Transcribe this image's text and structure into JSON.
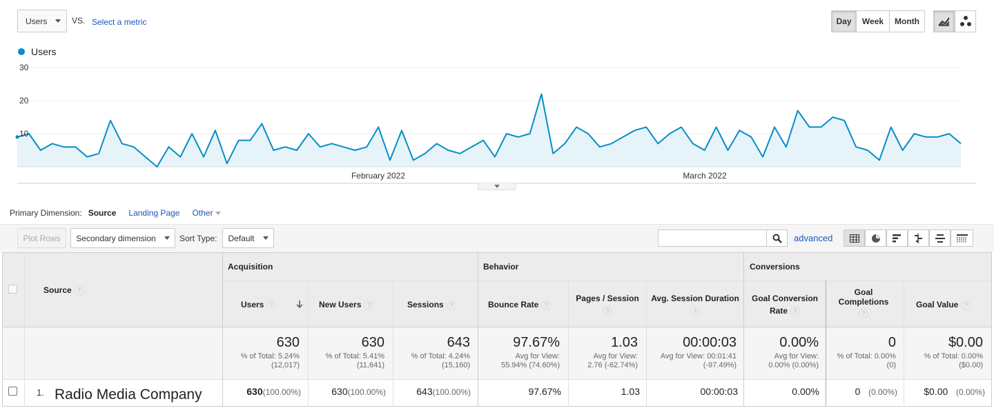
{
  "metric_bar": {
    "primary_metric": "Users",
    "vs_label": "VS.",
    "select_metric": "Select a metric"
  },
  "period": {
    "day": "Day",
    "week": "Week",
    "month": "Month",
    "active": "Day"
  },
  "chart_icons": [
    "line-chart-icon",
    "motion-chart-icon"
  ],
  "chart_data": {
    "type": "area",
    "series": [
      {
        "name": "Users",
        "color": "#058dc7",
        "values": [
          9,
          10,
          5,
          7,
          6,
          6,
          3,
          4,
          14,
          7,
          6,
          3,
          0,
          6,
          3,
          10,
          3,
          11,
          1,
          8,
          8,
          13,
          5,
          6,
          5,
          10,
          6,
          7,
          6,
          5,
          6,
          12,
          2,
          11,
          2,
          4,
          7,
          5,
          4,
          6,
          8,
          3,
          10,
          9,
          10,
          22,
          4,
          7,
          12,
          10,
          6,
          7,
          9,
          11,
          12,
          7,
          10,
          12,
          7,
          5,
          12,
          5,
          11,
          9,
          3,
          12,
          6,
          17,
          12,
          12,
          15,
          14,
          6,
          5,
          2,
          12,
          5,
          10,
          9,
          9,
          10,
          7
        ]
      }
    ],
    "y_ticks": [
      "10",
      "20",
      "30"
    ],
    "ylim": [
      0,
      30
    ],
    "x_labels": [
      "February 2022",
      "March 2022"
    ],
    "legend": "top-left",
    "grid": true
  },
  "dimension": {
    "label": "Primary Dimension:",
    "active": "Source",
    "options": [
      "Landing Page",
      "Other"
    ]
  },
  "toolbar": {
    "plot_rows": "Plot Rows",
    "secondary_dimension": "Secondary dimension",
    "sort_type_label": "Sort Type:",
    "sort_value": "Default",
    "search_value": "",
    "advanced": "advanced"
  },
  "view_icons": [
    "table-view-icon",
    "pie-view-icon",
    "performance-view-icon",
    "comparison-view-icon",
    "term-cloud-icon",
    "pivot-view-icon"
  ],
  "table": {
    "source_header": "Source",
    "groups": {
      "acquisition": "Acquisition",
      "behavior": "Behavior",
      "conversions": "Conversions"
    },
    "columns": {
      "users": "Users",
      "new_users": "New Users",
      "sessions": "Sessions",
      "bounce_rate": "Bounce Rate",
      "pages_session": "Pages / Session",
      "avg_duration": "Avg. Session Duration",
      "goal_conv_rate": "Goal Conversion Rate",
      "goal_completions": "Goal Completions",
      "goal_value": "Goal Value"
    },
    "totals": {
      "users": {
        "value": "630",
        "sub1": "% of Total: 5.24%",
        "sub2": "(12,017)"
      },
      "new_users": {
        "value": "630",
        "sub1": "% of Total: 5.41%",
        "sub2": "(11,641)"
      },
      "sessions": {
        "value": "643",
        "sub1": "% of Total: 4.24%",
        "sub2": "(15,160)"
      },
      "bounce_rate": {
        "value": "97.67%",
        "sub1": "Avg for View:",
        "sub2": "55.94% (74.60%)"
      },
      "pages_session": {
        "value": "1.03",
        "sub1": "Avg for View:",
        "sub2": "2.76 (-62.74%)"
      },
      "avg_duration": {
        "value": "00:00:03",
        "sub1": "Avg for View: 00:01:41",
        "sub2": "(-97.49%)"
      },
      "goal_conv_rate": {
        "value": "0.00%",
        "sub1": "Avg for View:",
        "sub2": "0.00% (0.00%)"
      },
      "goal_completions": {
        "value": "0",
        "sub1": "% of Total: 0.00%",
        "sub2": "(0)"
      },
      "goal_value": {
        "value": "$0.00",
        "sub1": "% of Total: 0.00%",
        "sub2": "($0.00)"
      }
    },
    "rows": [
      {
        "index": "1.",
        "source": "Radio Media Company",
        "users": "630",
        "users_pct": "(100.00%)",
        "new_users": "630",
        "new_users_pct": "(100.00%)",
        "sessions": "643",
        "sessions_pct": "(100.00%)",
        "bounce_rate": "97.67%",
        "pages_session": "1.03",
        "avg_duration": "00:00:03",
        "goal_conv_rate": "0.00%",
        "goal_completions": "0",
        "goal_completions_pct": "(0.00%)",
        "goal_value": "$0.00",
        "goal_value_pct": "(0.00%)"
      }
    ]
  }
}
